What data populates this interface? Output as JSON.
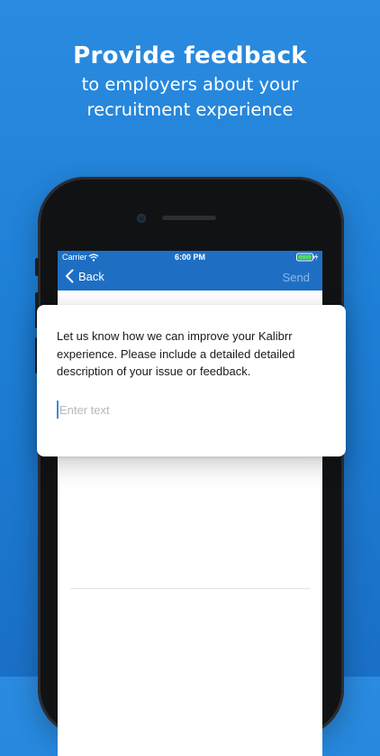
{
  "headline": {
    "title": "Provide feedback",
    "subtitle": "to employers about your recruitment experience"
  },
  "statusbar": {
    "carrier": "Carrier",
    "time": "6:00 PM"
  },
  "navbar": {
    "back_label": "Back",
    "send_label": "Send"
  },
  "feedback": {
    "prompt": "Let us know how we can improve your Kalibrr experience. Please include a detailed detailed description of your issue or feedback.",
    "input_value": "",
    "input_placeholder": "Enter text"
  },
  "colors": {
    "background_top": "#2a8be0",
    "background_bottom": "#1a70c6",
    "navbar": "#1e6fc4",
    "send_disabled": "#8fb7e6",
    "placeholder": "#b5b8be",
    "caret": "#3a8be0"
  },
  "icons": {
    "back": "chevron-left-icon",
    "wifi": "wifi-icon",
    "battery": "battery-icon",
    "camera": "camera-icon",
    "speaker": "speaker-grille"
  }
}
